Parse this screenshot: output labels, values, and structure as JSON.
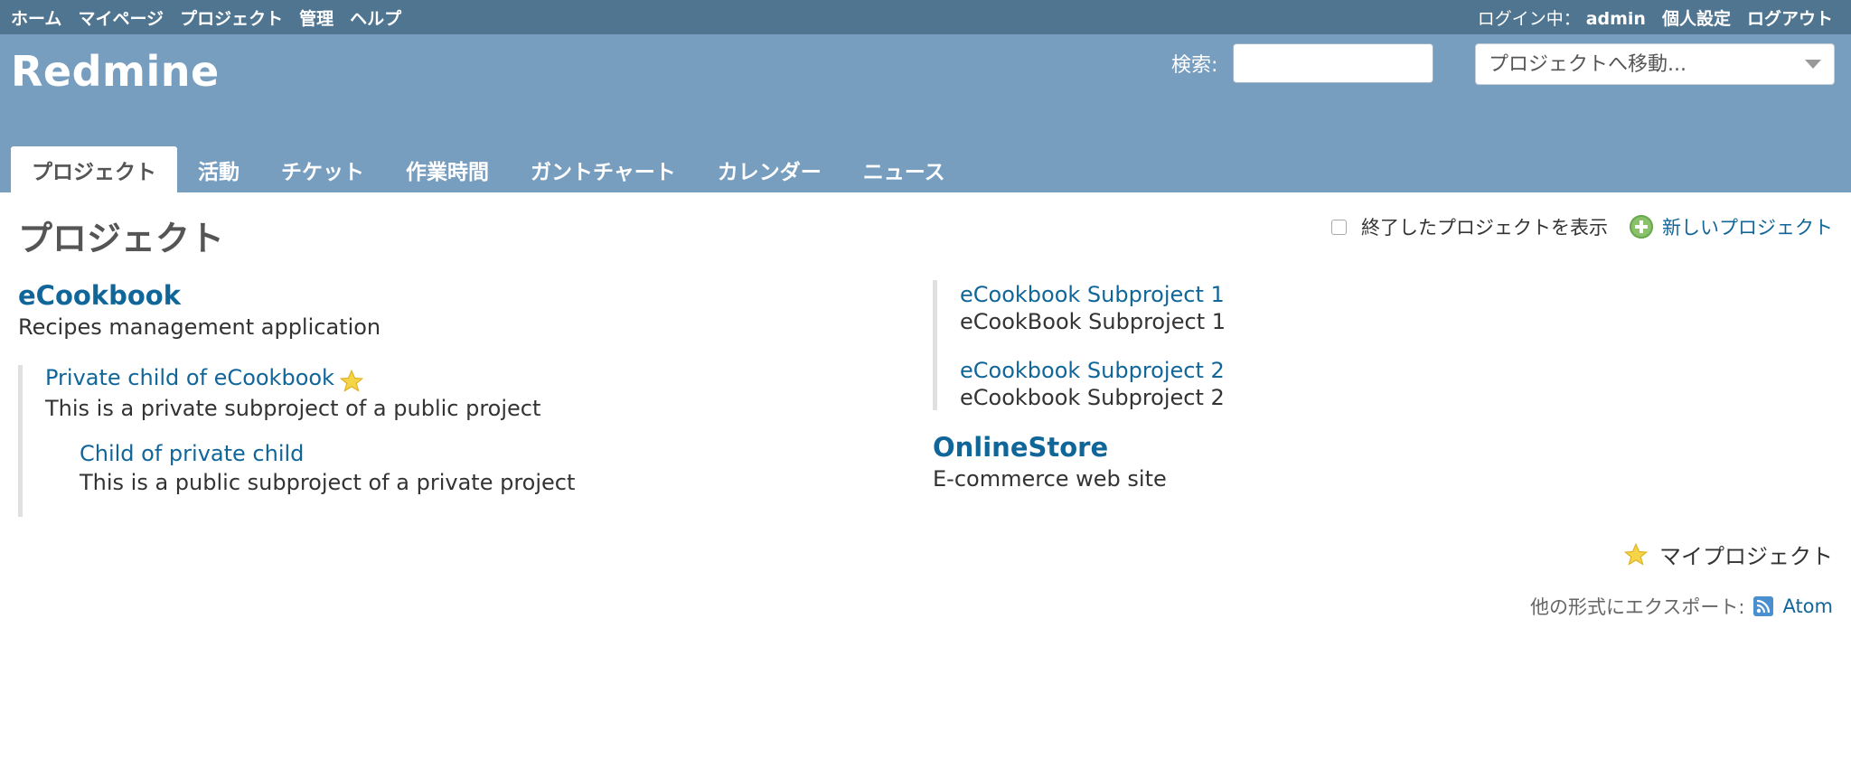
{
  "top_menu": {
    "items": [
      "ホーム",
      "マイページ",
      "プロジェクト",
      "管理",
      "ヘルプ"
    ],
    "logged_as": "ログイン中：",
    "user": "admin",
    "account": "個人設定",
    "logout": "ログアウト"
  },
  "header": {
    "title": "Redmine",
    "search_label": "検索:",
    "search_value": "",
    "project_jump": "プロジェクトへ移動..."
  },
  "main_menu": {
    "tabs": [
      "プロジェクト",
      "活動",
      "チケット",
      "作業時間",
      "ガントチャート",
      "カレンダー",
      "ニュース"
    ],
    "selected": "プロジェクト"
  },
  "content": {
    "title": "プロジェクト",
    "show_closed_label": "終了したプロジェクトを表示",
    "show_closed_checked": false,
    "new_project": "新しいプロジェクト"
  },
  "projects": {
    "ecookbook": {
      "name": "eCookbook",
      "description": "Recipes management application",
      "private_child": {
        "name": "Private child of eCookbook",
        "description": "This is a private subproject of a public project",
        "starred": true,
        "child": {
          "name": "Child of private child",
          "description": "This is a public subproject of a private project"
        }
      },
      "subproject1": {
        "name": "eCookbook Subproject 1",
        "description": "eCookBook Subproject 1"
      },
      "subproject2": {
        "name": "eCookbook Subproject 2",
        "description": "eCookbook Subproject 2"
      }
    },
    "onlinestore": {
      "name": "OnlineStore",
      "description": "E-commerce web site"
    }
  },
  "footer": {
    "my_projects": "マイプロジェクト",
    "export_label": "他の形式にエクスポート:",
    "atom": "Atom"
  },
  "colors": {
    "top_bar": "#507590",
    "header": "#779dbf",
    "link": "#116699",
    "star": "#f5c518"
  }
}
